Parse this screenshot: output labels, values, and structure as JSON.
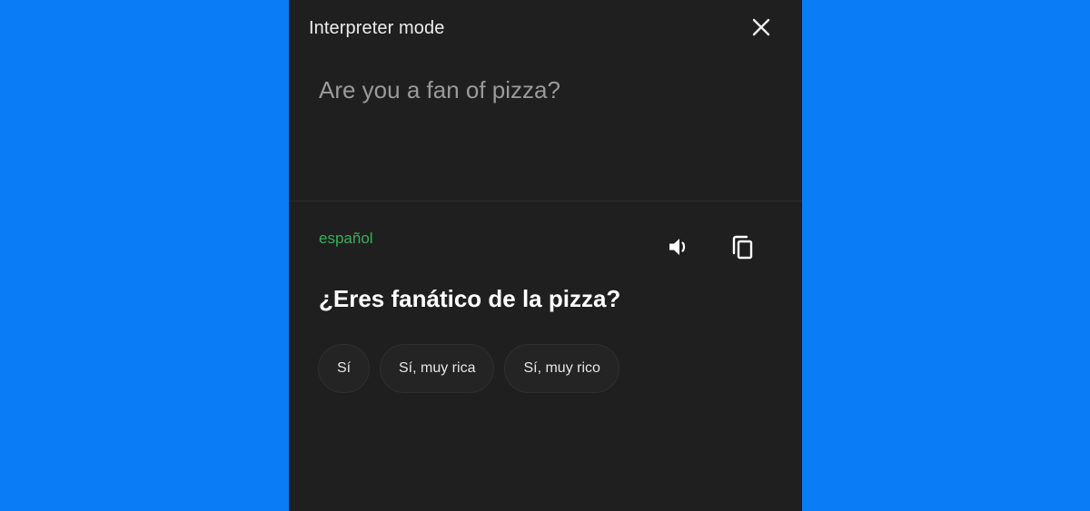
{
  "window": {
    "title": "Interpreter mode",
    "close_icon": "close-icon"
  },
  "source": {
    "text": "Are you a fan of pizza?"
  },
  "translation": {
    "language": "español",
    "language_color": "#3aae5a",
    "text": "¿Eres fanático de la pizza?",
    "speaker_icon": "speaker-icon",
    "copy_icon": "copy-icon"
  },
  "suggestions": [
    {
      "label": "Sí"
    },
    {
      "label": "Sí, muy rica"
    },
    {
      "label": "Sí, muy rico"
    }
  ],
  "colors": {
    "background": "#0a7cf5",
    "panel": "#1f1f1f"
  }
}
